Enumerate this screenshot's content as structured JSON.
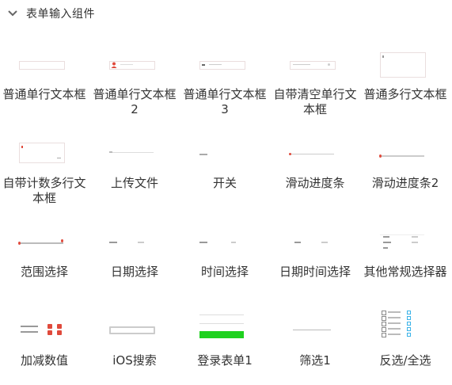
{
  "section": {
    "title": "表单输入组件",
    "chevron_icon": "chevron-down-icon"
  },
  "components": [
    {
      "label": "普通单行文本框",
      "thumb": "input-plain"
    },
    {
      "label": "普通单行文本框2",
      "thumb": "input-icon"
    },
    {
      "label": "普通单行文本框3",
      "thumb": "input-prefix"
    },
    {
      "label": "自带清空单行文本框",
      "thumb": "input-clear"
    },
    {
      "label": "普通多行文本框",
      "thumb": "textarea"
    },
    {
      "label": "自带计数多行文本框",
      "thumb": "textarea-count"
    },
    {
      "label": "上传文件",
      "thumb": "upload"
    },
    {
      "label": "开关",
      "thumb": "switch"
    },
    {
      "label": "滑动进度条",
      "thumb": "slider"
    },
    {
      "label": "滑动进度条2",
      "thumb": "slider2"
    },
    {
      "label": "范围选择",
      "thumb": "range"
    },
    {
      "label": "日期选择",
      "thumb": "date"
    },
    {
      "label": "时间选择",
      "thumb": "time"
    },
    {
      "label": "日期时间选择",
      "thumb": "datetime"
    },
    {
      "label": "其他常规选择器",
      "thumb": "picker"
    },
    {
      "label": "加减数值",
      "thumb": "stepper"
    },
    {
      "label": "iOS搜索",
      "thumb": "ios-search"
    },
    {
      "label": "登录表单1",
      "thumb": "login"
    },
    {
      "label": "筛选1",
      "thumb": "filter"
    },
    {
      "label": "反选/全选",
      "thumb": "checkbox-all"
    }
  ],
  "colors": {
    "accent": "#e04a3c",
    "green": "#1fd11f",
    "border": "#e0d6d6",
    "text": "#333333"
  }
}
